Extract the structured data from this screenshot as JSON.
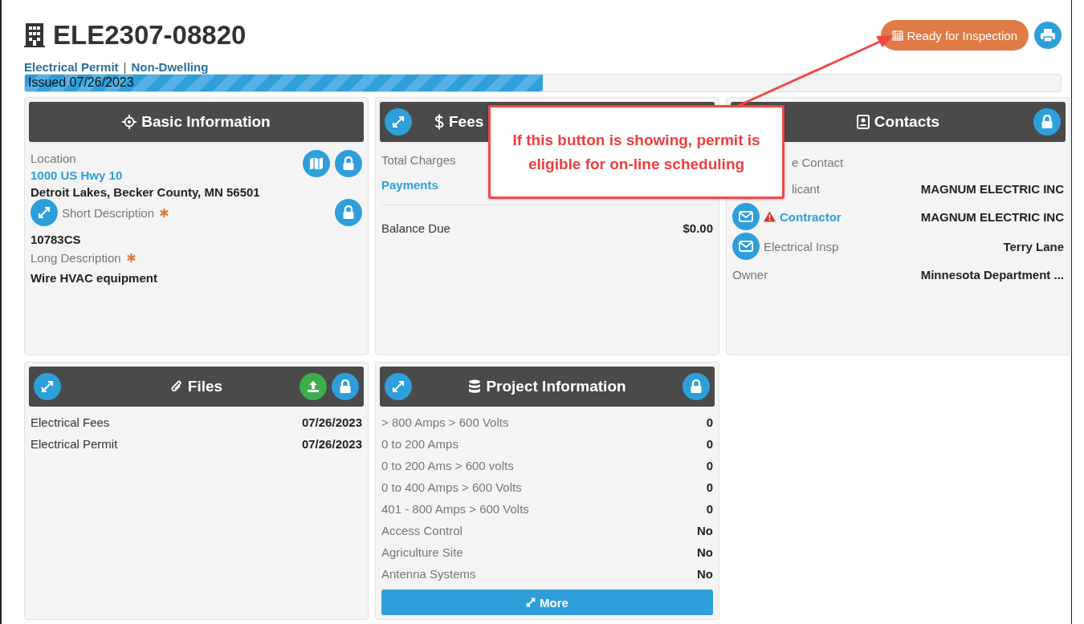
{
  "header": {
    "title": "ELE2307-08820",
    "permit_type": "Electrical Permit",
    "separator": "|",
    "category": "Non-Dwelling",
    "status_button": "Ready for Inspection"
  },
  "progress": {
    "label": "Issued 07/26/2023",
    "level": 0.5
  },
  "basic_information": {
    "title": "Basic Information",
    "location_label": "Location",
    "address": "1000 US Hwy 10",
    "city": "Detroit Lakes, Becker County, MN 56501",
    "fields": [
      {
        "label": "Short Description",
        "value": "10783CS",
        "required": true,
        "expandable": true
      },
      {
        "label": "Long Description",
        "value": "Wire HVAC equipment",
        "required": true,
        "expandable": false
      }
    ]
  },
  "fees": {
    "title": "Fees",
    "rows": [
      {
        "label": "Total Charges",
        "link": false
      },
      {
        "label": "Payments",
        "link": true
      }
    ],
    "balance_label": "Balance Due",
    "balance": "$0.00"
  },
  "contacts": {
    "title": "Contacts",
    "rows": [
      {
        "label": "e Contact",
        "kind": "covered",
        "link": false,
        "warning": false
      },
      {
        "label": "licant",
        "value": "MAGNUM ELECTRIC INC",
        "kind": "covered",
        "link": false,
        "warning": false
      },
      {
        "label": "Contractor",
        "value": "MAGNUM ELECTRIC INC",
        "kind": "email",
        "link": true,
        "warning": true
      },
      {
        "label": "Electrical Insp",
        "value": "Terry Lane",
        "kind": "email",
        "link": false,
        "warning": false
      },
      {
        "label": "Owner",
        "value": "Minnesota Department ...",
        "kind": "plain",
        "link": false,
        "warning": false
      }
    ]
  },
  "files": {
    "title": "Files",
    "rows": [
      {
        "name": "Electrical Fees",
        "date": "07/26/2023"
      },
      {
        "name": "Electrical Permit",
        "date": "07/26/2023"
      }
    ]
  },
  "project_information": {
    "title": "Project Information",
    "rows": [
      {
        "label": "> 800 Amps > 600 Volts",
        "value": "0"
      },
      {
        "label": "0 to 200 Amps",
        "value": "0"
      },
      {
        "label": "0 to 200 Ams > 600 volts",
        "value": "0"
      },
      {
        "label": "0 to 400 Amps > 600 Volts",
        "value": "0"
      },
      {
        "label": "401 - 800 Amps > 600 Volts",
        "value": "0"
      },
      {
        "label": "Access Control",
        "value": "No"
      },
      {
        "label": "Agriculture Site",
        "value": "No"
      },
      {
        "label": "Antenna Systems",
        "value": "No"
      }
    ],
    "more_button": "More"
  },
  "callout": {
    "text": "If this button is showing, permit is eligible for on-line scheduling"
  }
}
